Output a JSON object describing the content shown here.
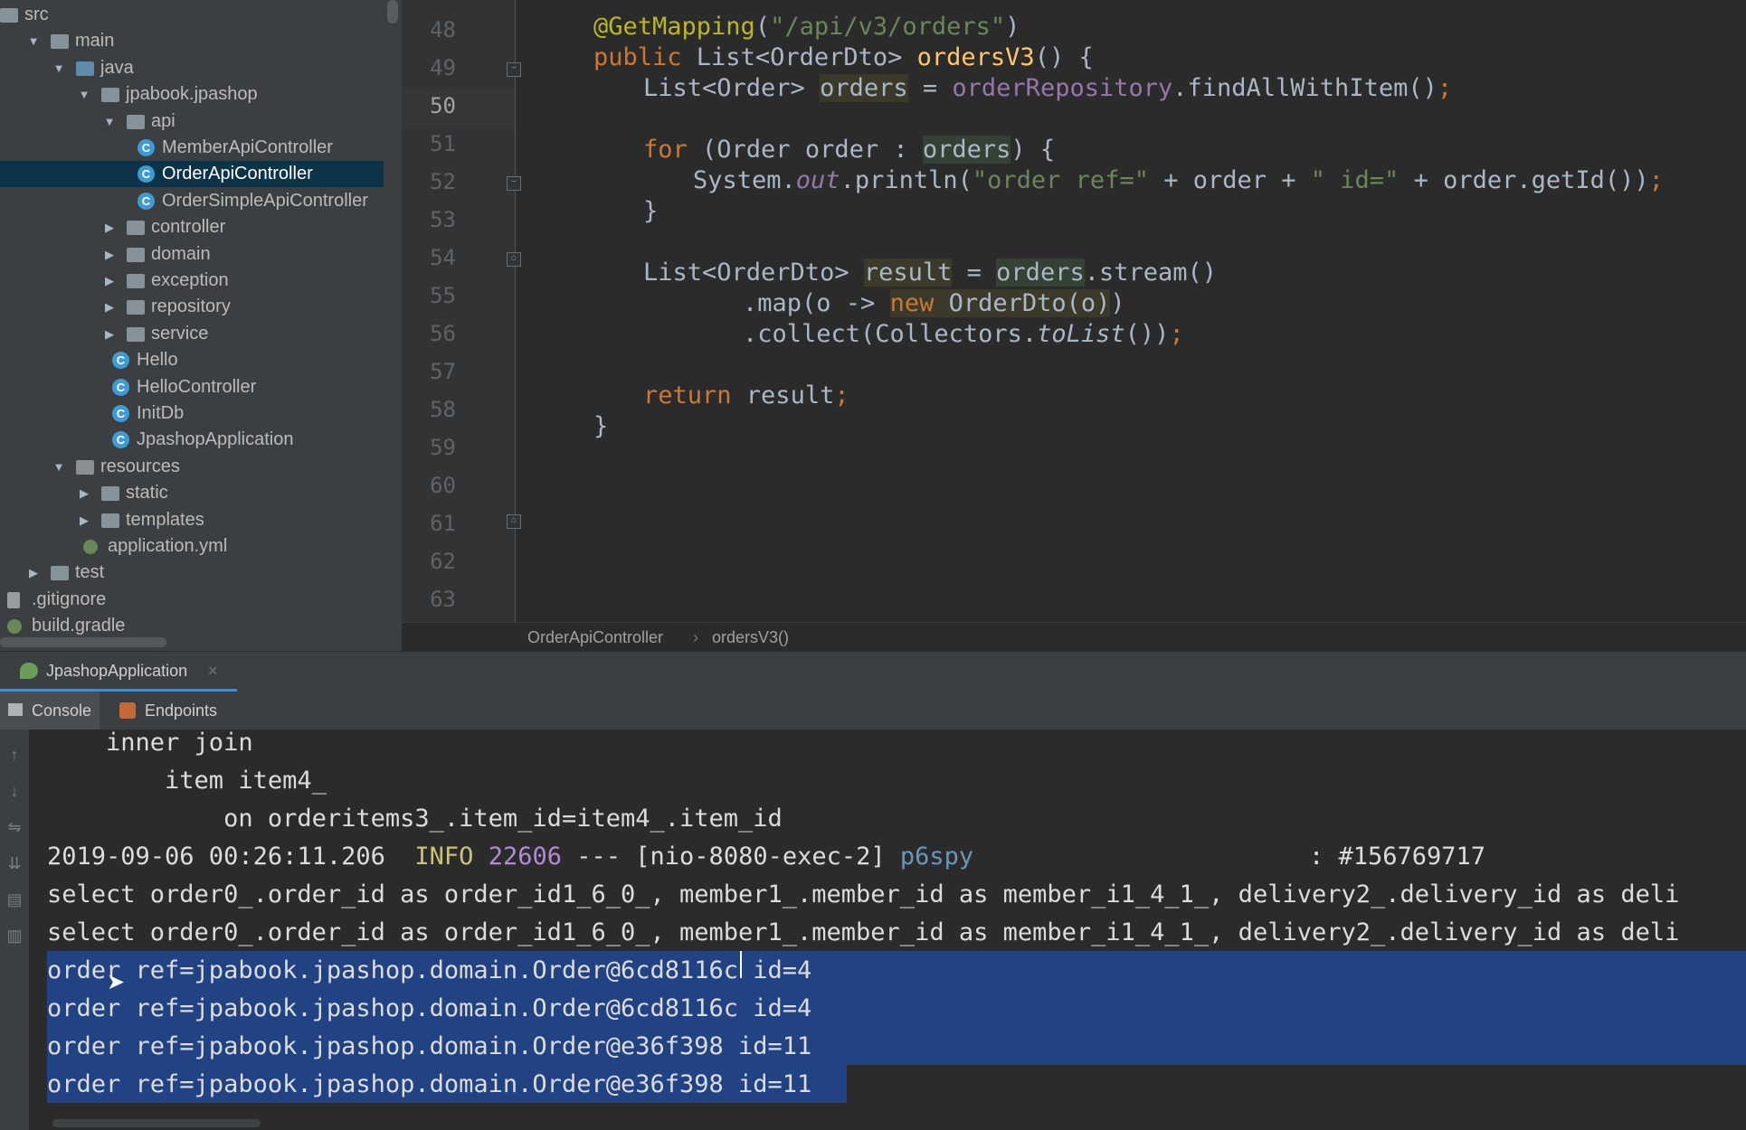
{
  "project_tree": {
    "items": [
      {
        "label": "src",
        "arrow": "",
        "icon": "folder"
      },
      {
        "label": "main",
        "arrow": "▼",
        "icon": "folder"
      },
      {
        "label": "java",
        "arrow": "▼",
        "icon": "folder-blue"
      },
      {
        "label": "jpabook.jpashop",
        "arrow": "▼",
        "icon": "package"
      },
      {
        "label": "api",
        "arrow": "▼",
        "icon": "package"
      },
      {
        "label": "MemberApiController",
        "arrow": "",
        "icon": "class"
      },
      {
        "label": "OrderApiController",
        "arrow": "",
        "icon": "class"
      },
      {
        "label": "OrderSimpleApiController",
        "arrow": "",
        "icon": "class"
      },
      {
        "label": "controller",
        "arrow": "▶",
        "icon": "package"
      },
      {
        "label": "domain",
        "arrow": "▶",
        "icon": "package"
      },
      {
        "label": "exception",
        "arrow": "▶",
        "icon": "package"
      },
      {
        "label": "repository",
        "arrow": "▶",
        "icon": "package"
      },
      {
        "label": "service",
        "arrow": "▶",
        "icon": "package"
      },
      {
        "label": "Hello",
        "arrow": "",
        "icon": "class"
      },
      {
        "label": "HelloController",
        "arrow": "",
        "icon": "class"
      },
      {
        "label": "InitDb",
        "arrow": "",
        "icon": "class"
      },
      {
        "label": "JpashopApplication",
        "arrow": "",
        "icon": "spring-class"
      },
      {
        "label": "resources",
        "arrow": "▼",
        "icon": "folder-res"
      },
      {
        "label": "static",
        "arrow": "▶",
        "icon": "folder"
      },
      {
        "label": "templates",
        "arrow": "▶",
        "icon": "folder"
      },
      {
        "label": "application.yml",
        "arrow": "",
        "icon": "yml"
      },
      {
        "label": "test",
        "arrow": "▶",
        "icon": "folder"
      },
      {
        "label": ".gitignore",
        "arrow": "",
        "icon": "file"
      },
      {
        "label": "build.gradle",
        "arrow": "",
        "icon": "gradle"
      }
    ],
    "selected": "OrderApiController"
  },
  "editor": {
    "line_numbers": [
      "48",
      "49",
      "50",
      "51",
      "52",
      "53",
      "54",
      "55",
      "56",
      "57",
      "58",
      "59",
      "60",
      "61",
      "62",
      "63"
    ],
    "current_line": "50",
    "code": {
      "l48": "@GetMapping(\"/api/v3/orders\")",
      "l49": "public List<OrderDto> ordersV3() {",
      "l50": "List<Order> orders = orderRepository.findAllWithItem();",
      "l52": "for (Order order : orders) {",
      "l53": "System.out.println(\"order ref=\" + order + \" id=\" + order.getId());",
      "l54": "}",
      "l56": "List<OrderDto> result = orders.stream()",
      "l57": ".map(o -> new OrderDto(o))",
      "l58": ".collect(Collectors.toList());",
      "l60": "return result;",
      "l61": "}"
    }
  },
  "breadcrumb": {
    "class": "OrderApiController",
    "separator": "›",
    "method": "ordersV3()"
  },
  "run_panel": {
    "tab_label": "JpashopApplication",
    "close": "×",
    "console_tab": "Console",
    "endpoints_tab": "Endpoints"
  },
  "console": {
    "lines": [
      "    inner join",
      "        item item4_",
      "            on orderitems3_.item_id=item4_.item_id",
      "select order0_.order_id as order_id1_6_0_, member1_.member_id as member_i1_4_1_, delivery2_.delivery_id as deli",
      "select order0_.order_id as order_id1_6_0_, member1_.member_id as member_i1_4_1_, delivery2_.delivery_id as deli",
      "order ref=jpabook.jpashop.domain.Order@6cd8116c id=4",
      "order ref=jpabook.jpashop.domain.Order@6cd8116c id=4",
      "order ref=jpabook.jpashop.domain.Order@e36f398 id=11",
      "order ref=jpabook.jpashop.domain.Order@e36f398 id=11"
    ],
    "log_line": {
      "timestamp": "2019-09-06 00:26:11.206",
      "level": "INFO",
      "pid": "22606",
      "separator": "---",
      "thread": "[nio-8080-exec-2]",
      "logger": "p6spy",
      "tail": ": #156769717"
    }
  },
  "colors": {
    "background": "#2b2b2b",
    "sidebar": "#3c3f41",
    "selection": "#214283",
    "keyword": "#cc7832",
    "string": "#6a8759",
    "method": "#ffc66d"
  }
}
